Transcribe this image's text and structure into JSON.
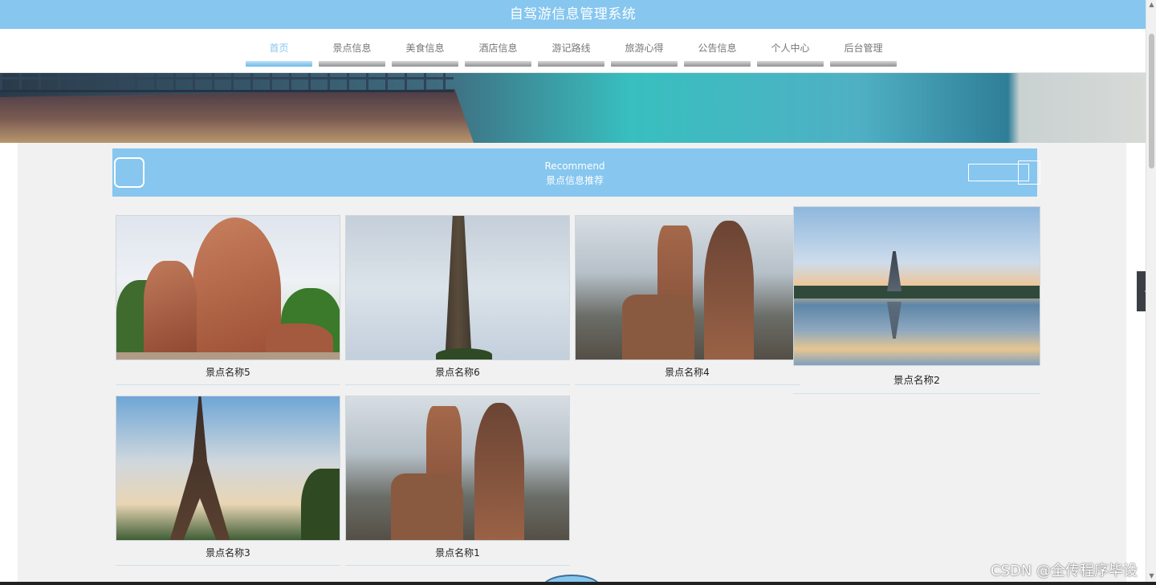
{
  "app": {
    "title": "自驾游信息管理系统"
  },
  "nav": {
    "items": [
      {
        "label": "首页",
        "active": true
      },
      {
        "label": "景点信息"
      },
      {
        "label": "美食信息"
      },
      {
        "label": "酒店信息"
      },
      {
        "label": "游记路线"
      },
      {
        "label": "旅游心得"
      },
      {
        "label": "公告信息"
      },
      {
        "label": "个人中心"
      },
      {
        "label": "后台管理"
      }
    ]
  },
  "recommend": {
    "title_en": "Recommend",
    "title_cn": "景点信息推荐"
  },
  "cards": [
    {
      "name": "景点名称5"
    },
    {
      "name": "景点名称6"
    },
    {
      "name": "景点名称4"
    },
    {
      "name": "景点名称2"
    },
    {
      "name": "景点名称3"
    },
    {
      "name": "景点名称1"
    }
  ],
  "colors": {
    "accent": "#86c6ef",
    "nav_inactive": "#777777",
    "content_bg": "#f1f1f1"
  },
  "watermark": "CSDN @全传程序毕设",
  "float_button_icon": "chevron-left-icon"
}
